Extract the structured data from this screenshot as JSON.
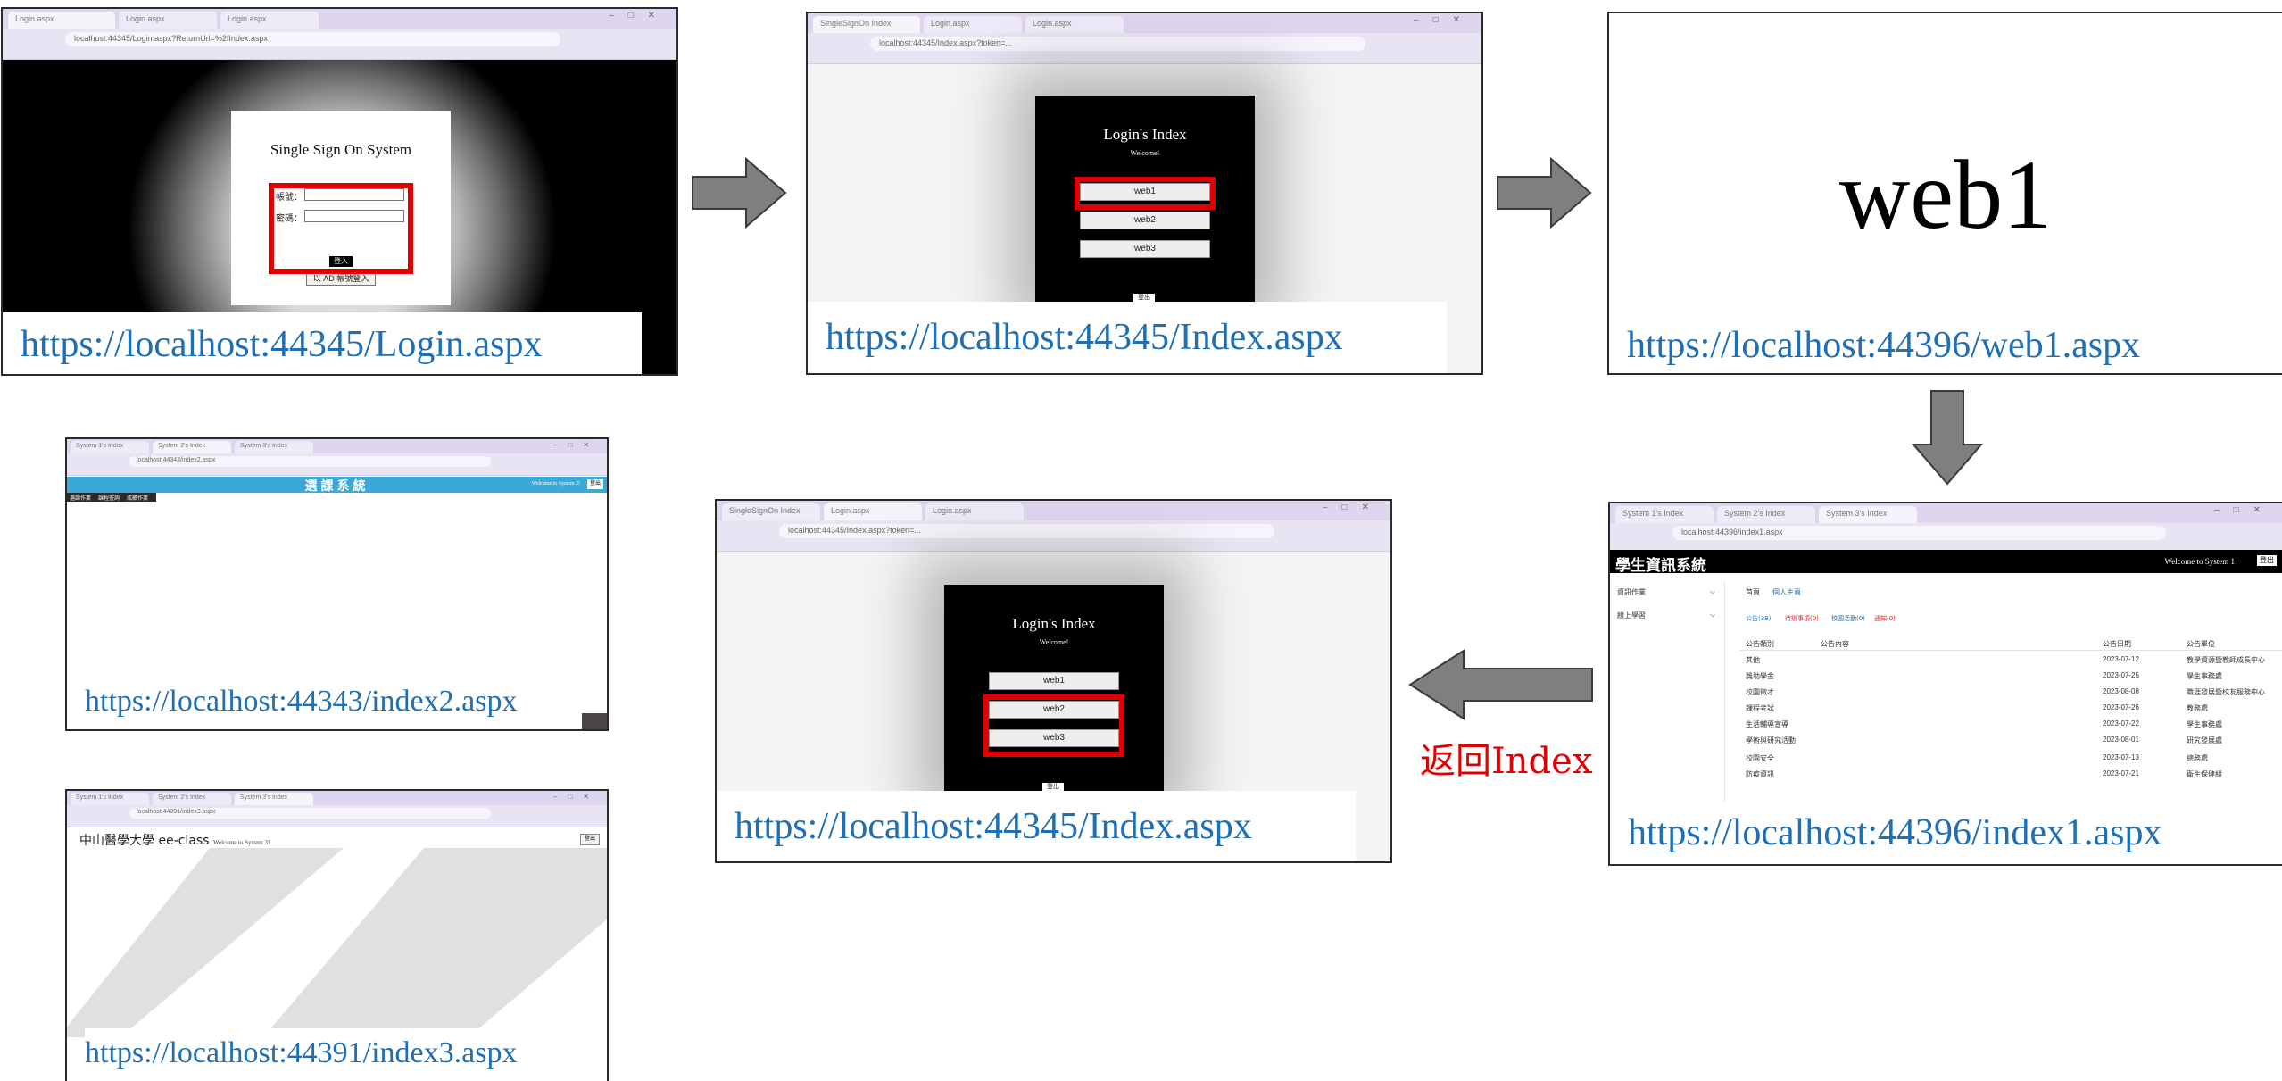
{
  "urls": {
    "login": "https://localhost:44345/Login.aspx",
    "index_top": "https://localhost:44345/Index.aspx",
    "web1": "https://localhost:44396/web1.aspx",
    "index1": "https://localhost:44396/index1.aspx",
    "index_mid": "https://localhost:44345/Index.aspx",
    "index2": "https://localhost:44343/index2.aspx",
    "index3": "https://localhost:44391/index3.aspx"
  },
  "login_panel": {
    "tabs": [
      "Login.aspx",
      "Login.aspx",
      "Login.aspx"
    ],
    "address": "localhost:44345/Login.aspx?ReturnUrl=%2fIndex.aspx",
    "title": "Single Sign On System",
    "account_label": "帳號：",
    "password_label": "密碼：",
    "login_button": "登入",
    "ad_button": "以 AD 帳號登入"
  },
  "index_panel": {
    "tabs": [
      "SingleSignOn Index",
      "Login.aspx",
      "Login.aspx"
    ],
    "address": "localhost:44345/Index.aspx?token=...",
    "title": "Login's Index",
    "subtitle": "Welcome!",
    "buttons": [
      "web1",
      "web2",
      "web3"
    ],
    "logout": "登出"
  },
  "web1_panel": {
    "heading": "web1"
  },
  "index1_panel": {
    "tabs": [
      "System 1's Index",
      "System 2's Index",
      "System 3's Index"
    ],
    "address": "localhost:44396/index1.aspx",
    "title": "學生資訊系統",
    "welcome": "Welcome to System 1!",
    "logout": "登出",
    "sidebar": [
      "資訊作業",
      "線上學習"
    ],
    "nav": [
      "首頁",
      "個人主頁"
    ],
    "tabs_inner": [
      "公告(38)",
      "待辦事項(0)",
      "校園活動(0)",
      "通知(0)"
    ],
    "headers": [
      "公告類別",
      "公告內容",
      "公告日期",
      "公告單位"
    ],
    "rows": [
      [
        "其他",
        "",
        "2023-07-12",
        "教學資源暨教師成長中心"
      ],
      [
        "獎助學金",
        "",
        "2023-07-25",
        "學生事務處"
      ],
      [
        "校園徵才",
        "",
        "2023-08-08",
        "職涯發展暨校友服務中心"
      ],
      [
        "課程考試",
        "",
        "2023-07-26",
        "教務處"
      ],
      [
        "生活輔導宣導",
        "",
        "2023-07-22",
        "學生事務處"
      ],
      [
        "學術與研究活動",
        "",
        "2023-08-01",
        "研究發展處"
      ],
      [
        "校園安全",
        "",
        "2023-07-13",
        "總務處"
      ],
      [
        "防疫資訊",
        "",
        "2023-07-21",
        "衛生保健組"
      ]
    ]
  },
  "back_label": "返回Index",
  "index2_panel": {
    "tabs": [
      "System 1's Index",
      "System 2's Index",
      "System 3's Index"
    ],
    "address": "localhost:44343/index2.aspx",
    "title": "選課系統",
    "welcome": "Welcome to System 2!",
    "logout": "登出",
    "menu": [
      "選課作業",
      "課程查詢",
      "成績作業"
    ]
  },
  "index3_panel": {
    "tabs": [
      "System 1's Index",
      "System 2's Index",
      "System 3's Index"
    ],
    "address": "localhost:44391/index3.aspx",
    "title": "中山醫學大學 ee-class",
    "welcome": "Welcome to System 3!",
    "logout": "登出"
  },
  "colors": {
    "url_blue": "#1f6fb5",
    "highlight_red": "#e00000",
    "arrow_gray": "#7f7f7f",
    "banner_teal": "#3aa9d6"
  }
}
